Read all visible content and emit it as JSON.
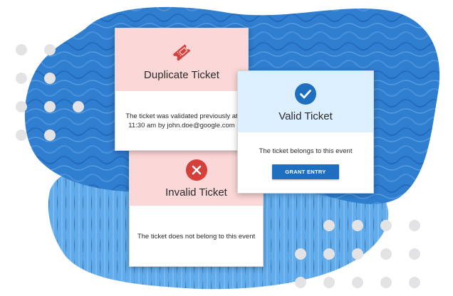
{
  "colors": {
    "blob_primary": "#2f7ed0",
    "blob_secondary": "#5aa7ea",
    "error_header": "#fcd7d7",
    "success_header": "#dcefff",
    "error_icon": "#d6403a",
    "success_icon": "#1f6fc1",
    "button": "#1f6fc1",
    "dots": "#e3e3e6"
  },
  "cards": {
    "duplicate": {
      "icon": "ticket-icon",
      "title": "Duplicate Ticket",
      "message_line1": "The ticket was validated previously at",
      "message_line2": "11:30 am by john.doe@google.com"
    },
    "invalid": {
      "icon": "close-circle-icon",
      "title": "Invalid Ticket",
      "message": "The ticket does not belong to this event"
    },
    "valid": {
      "icon": "check-circle-icon",
      "title": "Valid Ticket",
      "message": "The ticket belongs to this event",
      "button_label": "GRANT ENTRY"
    }
  }
}
